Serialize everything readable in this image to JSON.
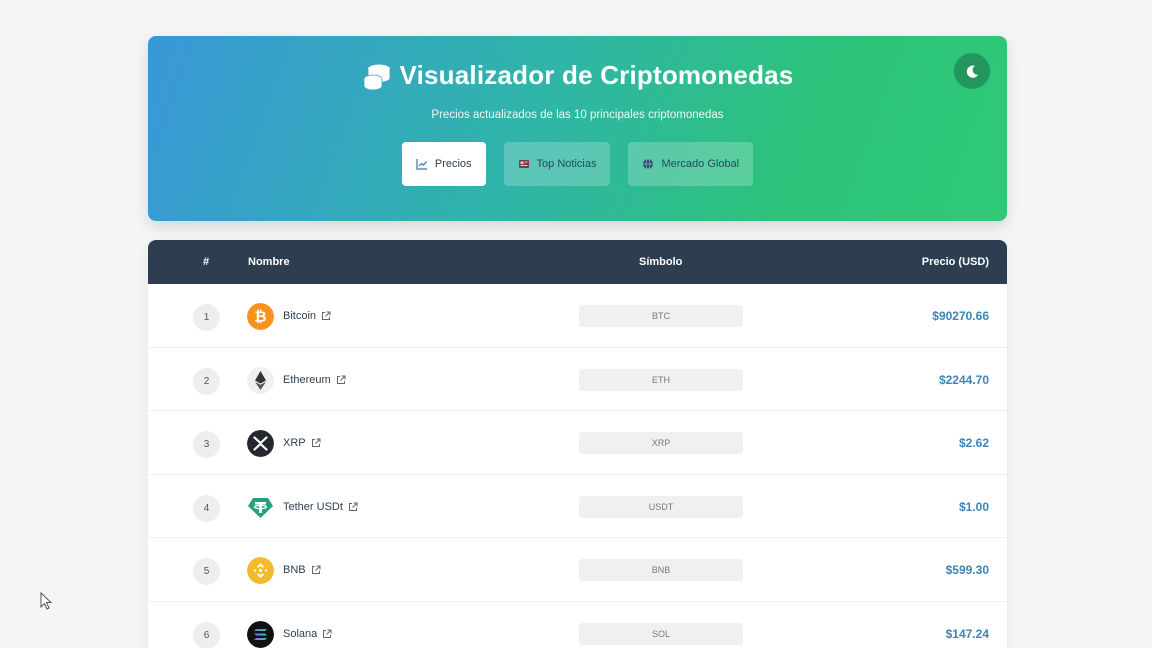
{
  "header": {
    "title": "Visualizador de Criptomonedas",
    "subtitle": "Precios actualizados de las 10 principales criptomonedas",
    "theme_toggle_icon": "moon-icon",
    "tabs": [
      {
        "label": "Precios",
        "icon": "chart-line-icon",
        "active": true
      },
      {
        "label": "Top Noticias",
        "icon": "newspaper-icon",
        "active": false
      },
      {
        "label": "Mercado Global",
        "icon": "globe-icon",
        "active": false
      }
    ]
  },
  "table": {
    "columns": {
      "rank": "#",
      "name": "Nombre",
      "symbol": "Símbolo",
      "price": "Precio (USD)"
    },
    "rows": [
      {
        "rank": "1",
        "name": "Bitcoin",
        "symbol": "BTC",
        "price": "$90270.66"
      },
      {
        "rank": "2",
        "name": "Ethereum",
        "symbol": "ETH",
        "price": "$2244.70"
      },
      {
        "rank": "3",
        "name": "XRP",
        "symbol": "XRP",
        "price": "$2.62"
      },
      {
        "rank": "4",
        "name": "Tether USDt",
        "symbol": "USDT",
        "price": "$1.00"
      },
      {
        "rank": "5",
        "name": "BNB",
        "symbol": "BNB",
        "price": "$599.30"
      },
      {
        "rank": "6",
        "name": "Solana",
        "symbol": "SOL",
        "price": "$147.24"
      }
    ]
  },
  "colors": {
    "header_gradient_start": "#3a97d8",
    "header_gradient_end": "#2ec977",
    "table_header": "#2c3e50",
    "price": "#3a86b8"
  }
}
